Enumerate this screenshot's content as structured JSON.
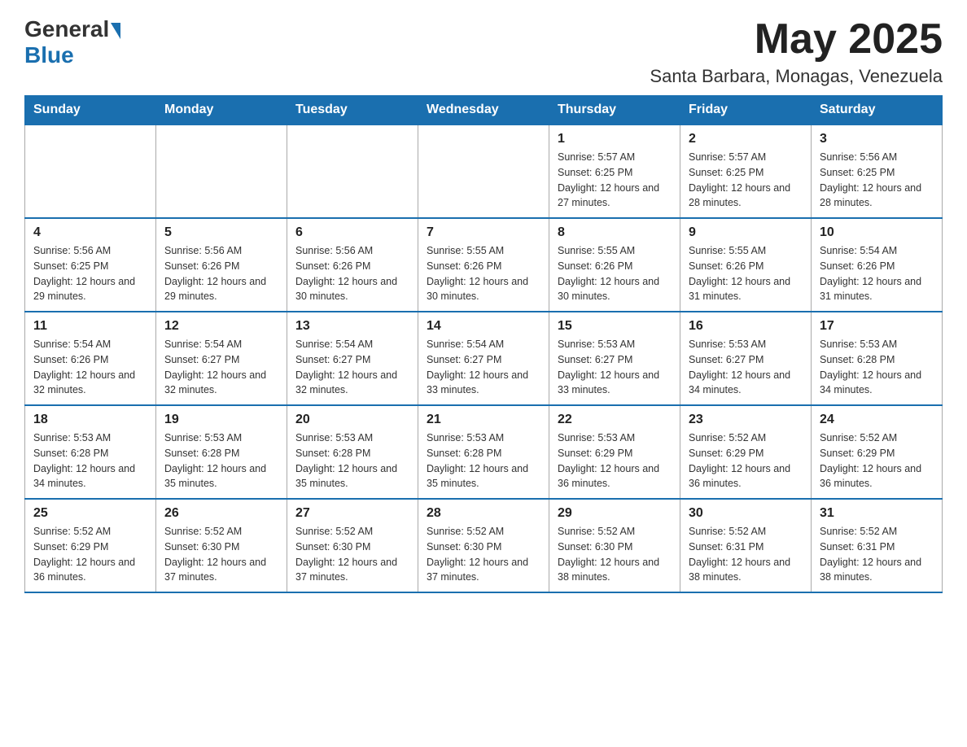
{
  "header": {
    "logo": {
      "general": "General",
      "blue": "Blue",
      "aria": "GeneralBlue logo"
    },
    "title": "May 2025",
    "location": "Santa Barbara, Monagas, Venezuela"
  },
  "calendar": {
    "days_of_week": [
      "Sunday",
      "Monday",
      "Tuesday",
      "Wednesday",
      "Thursday",
      "Friday",
      "Saturday"
    ],
    "weeks": [
      [
        {
          "day": "",
          "info": ""
        },
        {
          "day": "",
          "info": ""
        },
        {
          "day": "",
          "info": ""
        },
        {
          "day": "",
          "info": ""
        },
        {
          "day": "1",
          "info": "Sunrise: 5:57 AM\nSunset: 6:25 PM\nDaylight: 12 hours and 27 minutes."
        },
        {
          "day": "2",
          "info": "Sunrise: 5:57 AM\nSunset: 6:25 PM\nDaylight: 12 hours and 28 minutes."
        },
        {
          "day": "3",
          "info": "Sunrise: 5:56 AM\nSunset: 6:25 PM\nDaylight: 12 hours and 28 minutes."
        }
      ],
      [
        {
          "day": "4",
          "info": "Sunrise: 5:56 AM\nSunset: 6:25 PM\nDaylight: 12 hours and 29 minutes."
        },
        {
          "day": "5",
          "info": "Sunrise: 5:56 AM\nSunset: 6:26 PM\nDaylight: 12 hours and 29 minutes."
        },
        {
          "day": "6",
          "info": "Sunrise: 5:56 AM\nSunset: 6:26 PM\nDaylight: 12 hours and 30 minutes."
        },
        {
          "day": "7",
          "info": "Sunrise: 5:55 AM\nSunset: 6:26 PM\nDaylight: 12 hours and 30 minutes."
        },
        {
          "day": "8",
          "info": "Sunrise: 5:55 AM\nSunset: 6:26 PM\nDaylight: 12 hours and 30 minutes."
        },
        {
          "day": "9",
          "info": "Sunrise: 5:55 AM\nSunset: 6:26 PM\nDaylight: 12 hours and 31 minutes."
        },
        {
          "day": "10",
          "info": "Sunrise: 5:54 AM\nSunset: 6:26 PM\nDaylight: 12 hours and 31 minutes."
        }
      ],
      [
        {
          "day": "11",
          "info": "Sunrise: 5:54 AM\nSunset: 6:26 PM\nDaylight: 12 hours and 32 minutes."
        },
        {
          "day": "12",
          "info": "Sunrise: 5:54 AM\nSunset: 6:27 PM\nDaylight: 12 hours and 32 minutes."
        },
        {
          "day": "13",
          "info": "Sunrise: 5:54 AM\nSunset: 6:27 PM\nDaylight: 12 hours and 32 minutes."
        },
        {
          "day": "14",
          "info": "Sunrise: 5:54 AM\nSunset: 6:27 PM\nDaylight: 12 hours and 33 minutes."
        },
        {
          "day": "15",
          "info": "Sunrise: 5:53 AM\nSunset: 6:27 PM\nDaylight: 12 hours and 33 minutes."
        },
        {
          "day": "16",
          "info": "Sunrise: 5:53 AM\nSunset: 6:27 PM\nDaylight: 12 hours and 34 minutes."
        },
        {
          "day": "17",
          "info": "Sunrise: 5:53 AM\nSunset: 6:28 PM\nDaylight: 12 hours and 34 minutes."
        }
      ],
      [
        {
          "day": "18",
          "info": "Sunrise: 5:53 AM\nSunset: 6:28 PM\nDaylight: 12 hours and 34 minutes."
        },
        {
          "day": "19",
          "info": "Sunrise: 5:53 AM\nSunset: 6:28 PM\nDaylight: 12 hours and 35 minutes."
        },
        {
          "day": "20",
          "info": "Sunrise: 5:53 AM\nSunset: 6:28 PM\nDaylight: 12 hours and 35 minutes."
        },
        {
          "day": "21",
          "info": "Sunrise: 5:53 AM\nSunset: 6:28 PM\nDaylight: 12 hours and 35 minutes."
        },
        {
          "day": "22",
          "info": "Sunrise: 5:53 AM\nSunset: 6:29 PM\nDaylight: 12 hours and 36 minutes."
        },
        {
          "day": "23",
          "info": "Sunrise: 5:52 AM\nSunset: 6:29 PM\nDaylight: 12 hours and 36 minutes."
        },
        {
          "day": "24",
          "info": "Sunrise: 5:52 AM\nSunset: 6:29 PM\nDaylight: 12 hours and 36 minutes."
        }
      ],
      [
        {
          "day": "25",
          "info": "Sunrise: 5:52 AM\nSunset: 6:29 PM\nDaylight: 12 hours and 36 minutes."
        },
        {
          "day": "26",
          "info": "Sunrise: 5:52 AM\nSunset: 6:30 PM\nDaylight: 12 hours and 37 minutes."
        },
        {
          "day": "27",
          "info": "Sunrise: 5:52 AM\nSunset: 6:30 PM\nDaylight: 12 hours and 37 minutes."
        },
        {
          "day": "28",
          "info": "Sunrise: 5:52 AM\nSunset: 6:30 PM\nDaylight: 12 hours and 37 minutes."
        },
        {
          "day": "29",
          "info": "Sunrise: 5:52 AM\nSunset: 6:30 PM\nDaylight: 12 hours and 38 minutes."
        },
        {
          "day": "30",
          "info": "Sunrise: 5:52 AM\nSunset: 6:31 PM\nDaylight: 12 hours and 38 minutes."
        },
        {
          "day": "31",
          "info": "Sunrise: 5:52 AM\nSunset: 6:31 PM\nDaylight: 12 hours and 38 minutes."
        }
      ]
    ]
  }
}
